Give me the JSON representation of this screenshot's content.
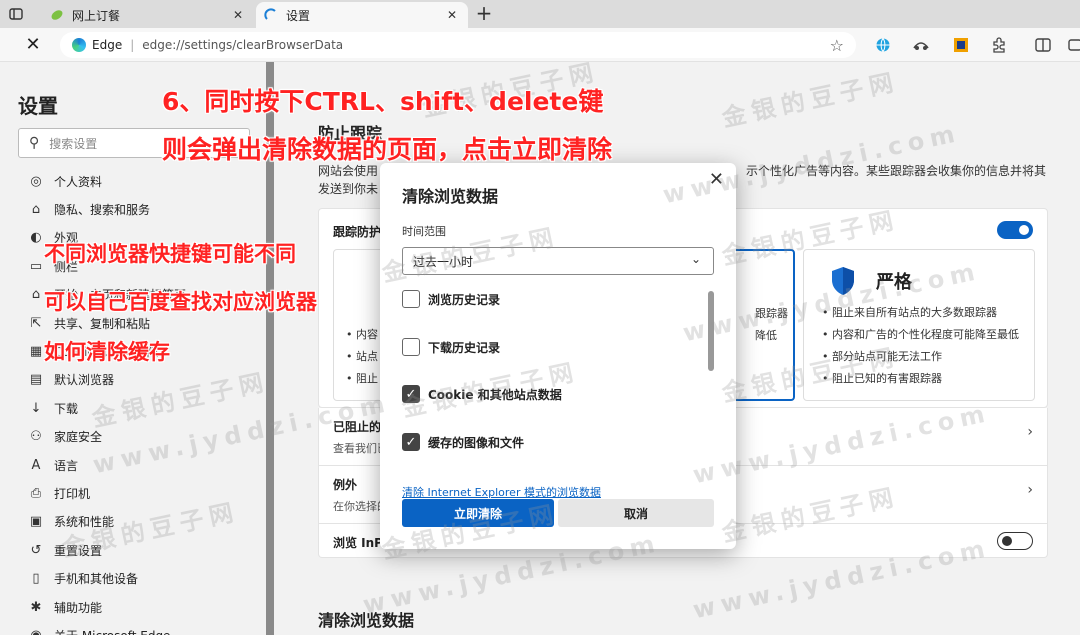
{
  "tabs": [
    {
      "title": "网上订餐",
      "favicon": "leaf-icon"
    },
    {
      "title": "设置",
      "favicon": "edge-settings-icon"
    }
  ],
  "addressbar": {
    "site_label": "Edge",
    "url": "edge://settings/clearBrowserData"
  },
  "sidebar": {
    "title": "设置",
    "search_placeholder": "搜索设置",
    "items": [
      {
        "label": "个人资料",
        "icon": "profile-icon"
      },
      {
        "label": "隐私、搜索和服务",
        "icon": "lock-icon"
      },
      {
        "label": "外观",
        "icon": "appearance-icon"
      },
      {
        "label": "侧栏",
        "icon": "sidebar-icon"
      },
      {
        "label": "开始、主页和新建标签页",
        "icon": "home-icon"
      },
      {
        "label": "共享、复制和粘贴",
        "icon": "share-icon"
      },
      {
        "label": "Cookie 和网站权限",
        "icon": "cookie-icon"
      },
      {
        "label": "默认浏览器",
        "icon": "browser-icon"
      },
      {
        "label": "下载",
        "icon": "download-icon"
      },
      {
        "label": "家庭安全",
        "icon": "family-icon"
      },
      {
        "label": "语言",
        "icon": "language-icon"
      },
      {
        "label": "打印机",
        "icon": "printer-icon"
      },
      {
        "label": "系统和性能",
        "icon": "system-icon"
      },
      {
        "label": "重置设置",
        "icon": "reset-icon"
      },
      {
        "label": "手机和其他设备",
        "icon": "phone-icon"
      },
      {
        "label": "辅助功能",
        "icon": "accessibility-icon"
      },
      {
        "label": "关于 Microsoft Edge",
        "icon": "edge-icon"
      }
    ]
  },
  "main": {
    "heading": "防止跟踪",
    "desc_line1": "网站会使用",
    "desc_right": "示个性化广告等内容。某些跟踪器会收集你的信息并将其",
    "desc_line2": "发送到你未",
    "tracking_label": "跟踪防护",
    "strict_name": "严格",
    "strict_bullets": [
      "阻止来自所有站点的大多数跟踪器",
      "内容和广告的个性化程度可能降至最低",
      "部分站点可能无法工作",
      "阻止已知的有害跟踪器"
    ],
    "balanced_bullets": [
      "跟踪器",
      "降低"
    ],
    "basic_bullets": [
      "内容",
      "站点",
      "阻止"
    ],
    "row_blocked_title": "已阻止的",
    "row_blocked_sub": "查看我们已",
    "row_exceptions_title": "例外",
    "row_exceptions_sub": "在你选择的",
    "row_inprivate_title": "浏览 InP",
    "clear_heading": "清除浏览数据"
  },
  "dialog": {
    "title": "清除浏览数据",
    "time_range_label": "时间范围",
    "time_range_value": "过去一小时",
    "items": [
      {
        "label": "浏览历史记录",
        "checked": false
      },
      {
        "label": "下载历史记录",
        "checked": false
      },
      {
        "label": "Cookie 和其他站点数据",
        "checked": true
      },
      {
        "label": "缓存的图像和文件",
        "checked": true
      }
    ],
    "ie_link": "清除 Internet Explorer 模式的浏览数据",
    "clear_button": "立即清除",
    "cancel_button": "取消"
  },
  "annotations": {
    "line1": "6、同时按下CTRL、shift、delete键",
    "line2": "则会弹出清除数据的页面，点击立即清除",
    "line3": "不同浏览器快捷键可能不同",
    "line4": "可以自己百度查找对应浏览器",
    "line5": "如何清除缓存"
  },
  "watermark": {
    "cn": "金银的豆子网",
    "url": "www.jyddzi.com"
  },
  "colors": {
    "accent": "#0a63c4",
    "annotation": "#ff2222"
  }
}
